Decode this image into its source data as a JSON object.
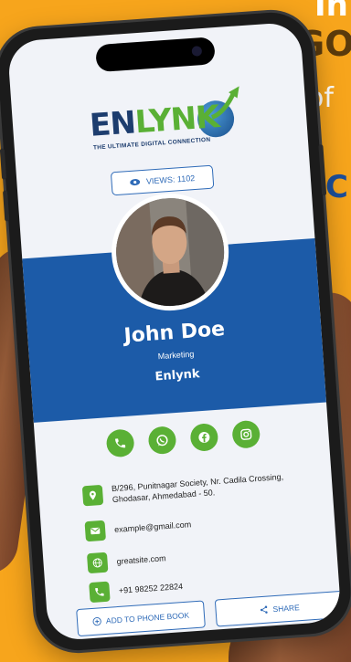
{
  "background": {
    "line1": "In",
    "line2": "GO",
    "line3": "of",
    "line4": "C",
    "colors": {
      "orange": "#f7a51c",
      "dark": "#5a3a0c",
      "blue": "#1d4f9a"
    }
  },
  "logo": {
    "part1": "EN",
    "part2": "LYNK",
    "tagline": "THE ULTIMATE DIGITAL CONNECTION"
  },
  "views": {
    "icon": "eye-icon",
    "label": "VIEWS: 1102"
  },
  "profile": {
    "name": "John Doe",
    "role": "Marketing",
    "company": "Enlynk"
  },
  "socials": [
    {
      "icon": "phone-icon"
    },
    {
      "icon": "whatsapp-icon"
    },
    {
      "icon": "facebook-icon"
    },
    {
      "icon": "instagram-icon"
    }
  ],
  "contacts": {
    "address_line1": "B/296, Punitnagar Society, Nr. Cadila Crossing,",
    "address_line2": "Ghodasar, Ahmedabad - 50.",
    "email": "example@gmail.com",
    "website": "greatsite.com",
    "phone": "+91 98252 22824"
  },
  "buttons": {
    "add": "ADD TO PHONE BOOK",
    "share": "SHARE"
  },
  "colors": {
    "brand_blue": "#1c5ba8",
    "brand_green": "#5ab035",
    "navy": "#1d3d6e"
  }
}
